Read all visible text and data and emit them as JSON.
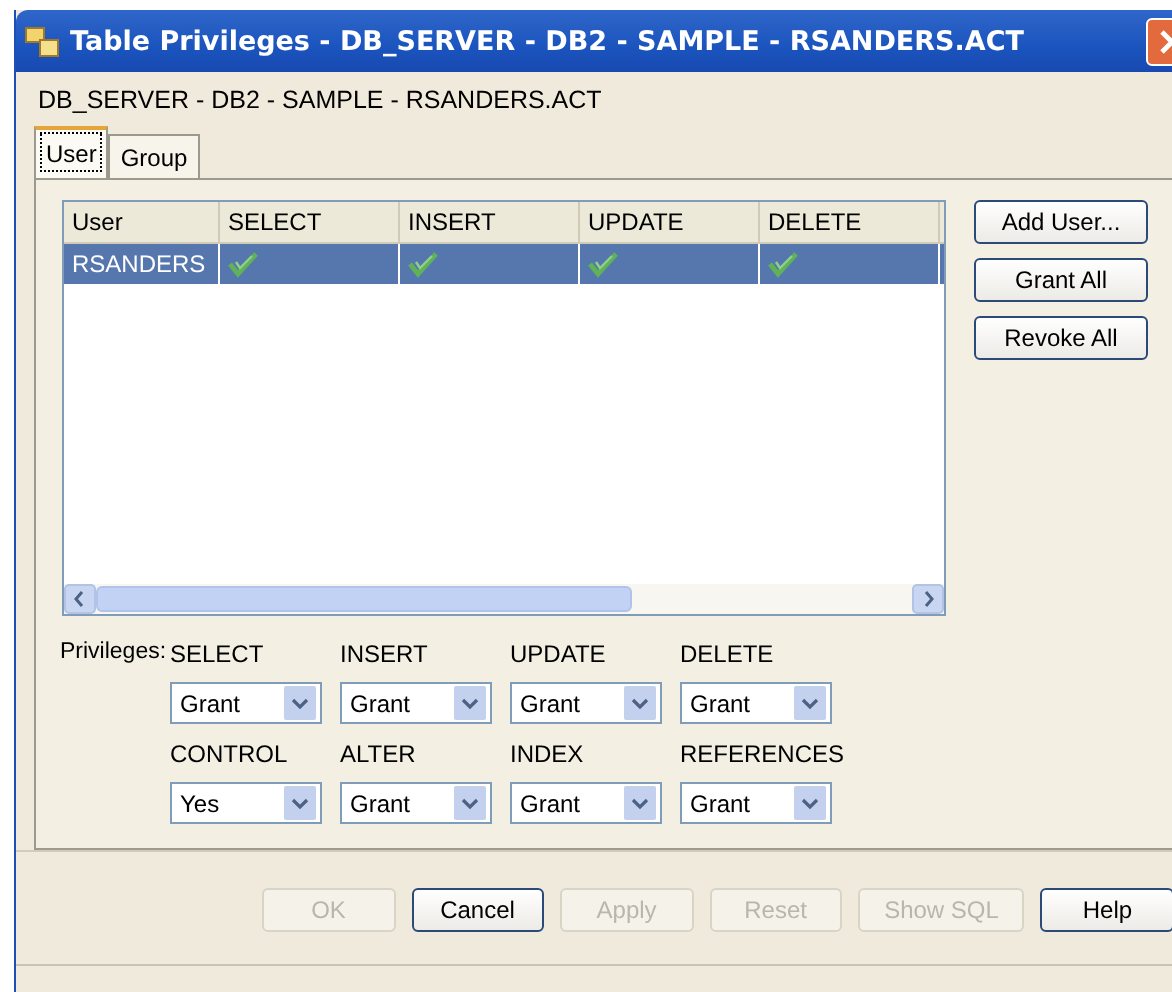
{
  "window": {
    "title": "Table Privileges - DB_SERVER - DB2 - SAMPLE - RSANDERS.ACT"
  },
  "subtitle": "DB_SERVER - DB2 - SAMPLE - RSANDERS.ACT",
  "tabs": [
    {
      "label": "User",
      "selected": true
    },
    {
      "label": "Group",
      "selected": false
    }
  ],
  "table": {
    "columns": [
      "User",
      "SELECT",
      "INSERT",
      "UPDATE",
      "DELETE"
    ],
    "rows": [
      {
        "user": "RSANDERS",
        "selected": true,
        "grants": [
          true,
          true,
          true,
          true
        ]
      }
    ]
  },
  "side_buttons": [
    "Add User...",
    "Grant All",
    "Revoke All"
  ],
  "privileges": {
    "label": "Privileges:",
    "fields": [
      {
        "label": "SELECT",
        "value": "Grant"
      },
      {
        "label": "INSERT",
        "value": "Grant"
      },
      {
        "label": "UPDATE",
        "value": "Grant"
      },
      {
        "label": "DELETE",
        "value": "Grant"
      },
      {
        "label": "CONTROL",
        "value": "Yes"
      },
      {
        "label": "ALTER",
        "value": "Grant"
      },
      {
        "label": "INDEX",
        "value": "Grant"
      },
      {
        "label": "REFERENCES",
        "value": "Grant"
      }
    ]
  },
  "buttons": [
    {
      "label": "OK",
      "disabled": true
    },
    {
      "label": "Cancel",
      "disabled": false
    },
    {
      "label": "Apply",
      "disabled": true
    },
    {
      "label": "Reset",
      "disabled": true
    },
    {
      "label": "Show SQL",
      "disabled": true
    },
    {
      "label": "Help",
      "disabled": false
    }
  ]
}
